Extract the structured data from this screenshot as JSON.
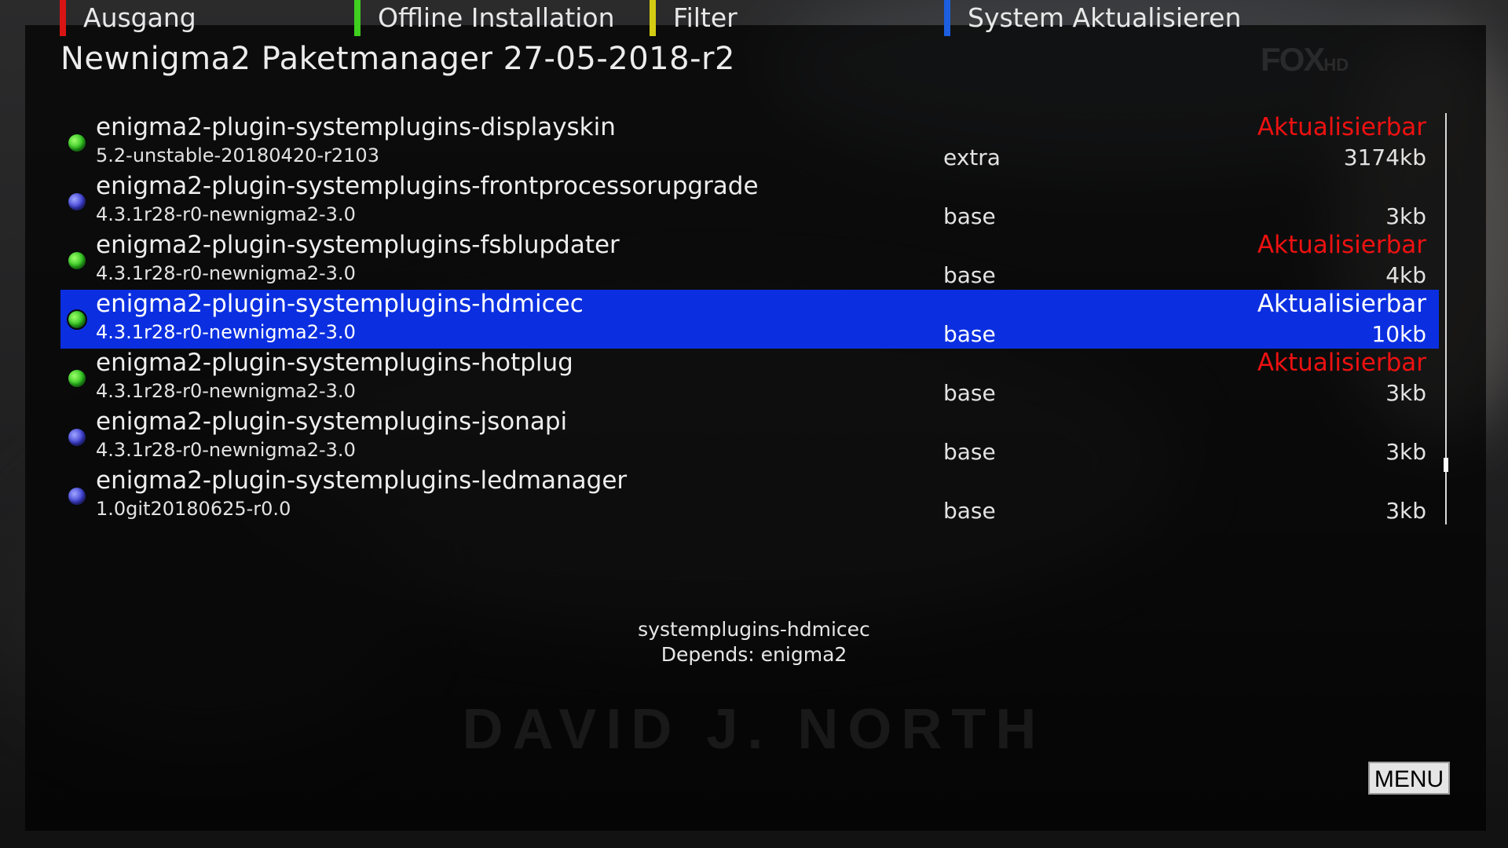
{
  "window": {
    "title": "Newnigma2 Paketmanager 27-05-2018-r2",
    "channel_logo": "FOX",
    "channel_logo_suffix": "HD"
  },
  "packages": [
    {
      "name": "enigma2-plugin-systemplugins-displayskin",
      "version": "5.2-unstable-20180420-r2103",
      "feed": "extra",
      "status": "Aktualisierbar",
      "size": "3174kb",
      "indicator": "green",
      "selected": false
    },
    {
      "name": "enigma2-plugin-systemplugins-frontprocessorupgrade",
      "version": "4.3.1r28-r0-newnigma2-3.0",
      "feed": "base",
      "status": "",
      "size": "3kb",
      "indicator": "blue",
      "selected": false
    },
    {
      "name": "enigma2-plugin-systemplugins-fsblupdater",
      "version": "4.3.1r28-r0-newnigma2-3.0",
      "feed": "base",
      "status": "Aktualisierbar",
      "size": "4kb",
      "indicator": "green",
      "selected": false
    },
    {
      "name": "enigma2-plugin-systemplugins-hdmicec",
      "version": "4.3.1r28-r0-newnigma2-3.0",
      "feed": "base",
      "status": "Aktualisierbar",
      "size": "10kb",
      "indicator": "green",
      "selected": true
    },
    {
      "name": "enigma2-plugin-systemplugins-hotplug",
      "version": "4.3.1r28-r0-newnigma2-3.0",
      "feed": "base",
      "status": "Aktualisierbar",
      "size": "3kb",
      "indicator": "green",
      "selected": false
    },
    {
      "name": "enigma2-plugin-systemplugins-jsonapi",
      "version": "4.3.1r28-r0-newnigma2-3.0",
      "feed": "base",
      "status": "",
      "size": "3kb",
      "indicator": "blue",
      "selected": false
    },
    {
      "name": "enigma2-plugin-systemplugins-ledmanager",
      "version": "1.0git20180625-r0.0",
      "feed": "base",
      "status": "",
      "size": "3kb",
      "indicator": "blue",
      "selected": false
    }
  ],
  "description": {
    "line1": "systemplugins-hdmicec",
    "line2": "Depends: enigma2"
  },
  "background_text": {
    "credit_name": "DAVID J. NORTH"
  },
  "footer": {
    "red_label": "Ausgang",
    "green_label": "Offline Installation",
    "yellow_label": "Filter",
    "blue_label": "System Aktualisieren",
    "menu_label": "MENU"
  },
  "colors": {
    "selection": "#0b2fe0",
    "status_update": "#ee1111",
    "key_red": "#d81414",
    "key_green": "#3fcf1f",
    "key_yellow": "#d4cc12",
    "key_blue": "#1d5fe0"
  }
}
